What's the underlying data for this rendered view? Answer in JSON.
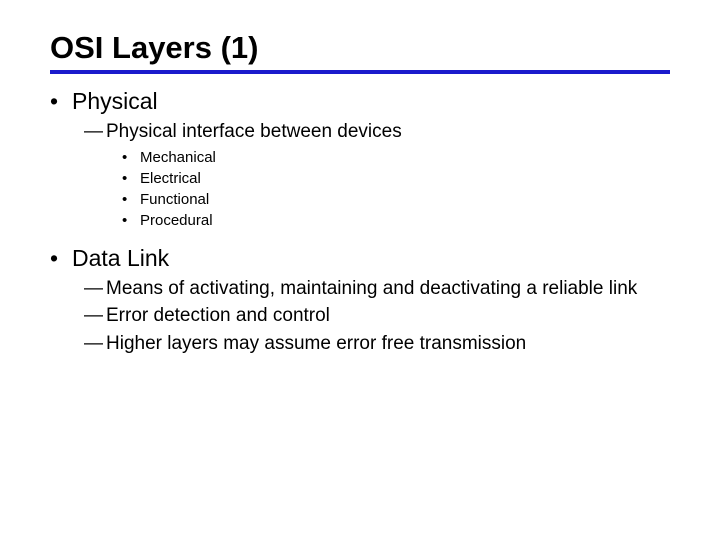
{
  "title": "OSI Layers (1)",
  "items": [
    {
      "label": "Physical",
      "subs": [
        {
          "text": "Physical interface between devices",
          "subsubs": [
            "Mechanical",
            "Electrical",
            "Functional",
            "Procedural"
          ]
        }
      ]
    },
    {
      "label": "Data Link",
      "subs": [
        {
          "text": "Means of activating, maintaining and deactivating a reliable link"
        },
        {
          "text": "Error detection and control"
        },
        {
          "text": "Higher layers may assume error free transmission"
        }
      ]
    }
  ]
}
